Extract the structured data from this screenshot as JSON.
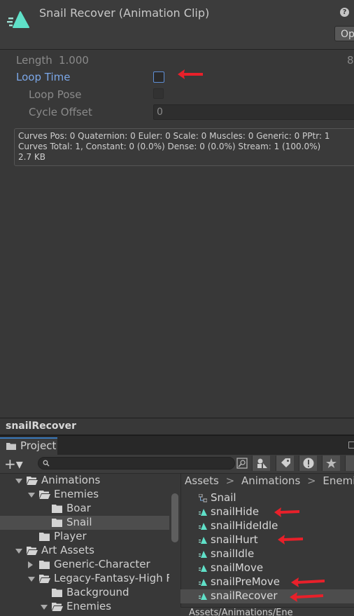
{
  "inspector": {
    "title": "Snail Recover (Animation Clip)",
    "help_icon": "?",
    "open_button": "Op",
    "length_label": "Length",
    "length_value": "1.000",
    "frames_value": "8",
    "loop_time_label": "Loop Time",
    "loop_time_checked": false,
    "loop_pose_label": "Loop Pose",
    "cycle_offset_label": "Cycle Offset",
    "cycle_offset_value": "0",
    "stats": [
      "Curves Pos: 0 Quaternion: 0 Euler: 0 Scale: 0 Muscles: 0 Generic: 0 PPtr: 1",
      "Curves Total: 1, Constant: 0 (0.0%) Dense: 0 (0.0%) Stream: 1 (100.0%)",
      "2.7 KB"
    ]
  },
  "preview": {
    "title": "snailRecover"
  },
  "project": {
    "tab_label": "Project",
    "create_button": "+▾",
    "search_placeholder": "",
    "tree": [
      {
        "label": "Animations",
        "depth": 0,
        "fold": "open"
      },
      {
        "label": "Enemies",
        "depth": 1,
        "fold": "open"
      },
      {
        "label": "Boar",
        "depth": 2,
        "fold": "none"
      },
      {
        "label": "Snail",
        "depth": 2,
        "fold": "none",
        "selected": true
      },
      {
        "label": "Player",
        "depth": 1,
        "fold": "none"
      },
      {
        "label": "Art Assets",
        "depth": 0,
        "fold": "open"
      },
      {
        "label": "Generic-Character",
        "depth": 1,
        "fold": "closed"
      },
      {
        "label": "Legacy-Fantasy-High F",
        "depth": 1,
        "fold": "open"
      },
      {
        "label": "Background",
        "depth": 2,
        "fold": "none"
      },
      {
        "label": "Enemies",
        "depth": 2,
        "fold": "open"
      }
    ],
    "breadcrumb": [
      "Assets",
      "Animations",
      "Enemies"
    ],
    "breadcrumb_sep": ">",
    "assets": [
      {
        "label": "Snail",
        "icon": "animator-controller-icon"
      },
      {
        "label": "snailHide",
        "icon": "animation-clip-icon"
      },
      {
        "label": "snailHideIdle",
        "icon": "animation-clip-icon"
      },
      {
        "label": "snailHurt",
        "icon": "animation-clip-icon"
      },
      {
        "label": "snailIdle",
        "icon": "animation-clip-icon"
      },
      {
        "label": "snailMove",
        "icon": "animation-clip-icon"
      },
      {
        "label": "snailPreMove",
        "icon": "animation-clip-icon"
      },
      {
        "label": "snailRecover",
        "icon": "animation-clip-icon",
        "selected": true
      }
    ],
    "path_bar": "Assets/Animations/Ene"
  },
  "colors": {
    "accent": "#3a79bb",
    "annotation_arrow": "#e8202a",
    "clip_icon": "#5fe0c8"
  }
}
